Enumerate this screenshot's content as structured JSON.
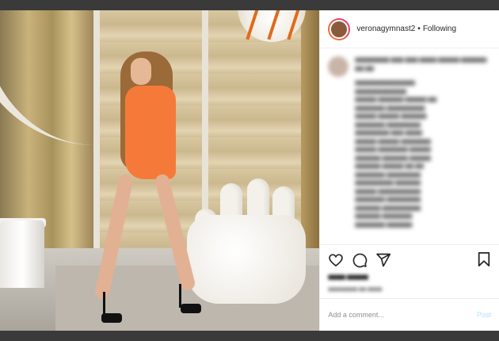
{
  "post": {
    "username": "veronagymnast2",
    "separator": "•",
    "follow_status": "Following",
    "caption_blurred": true
  },
  "actions": {
    "like_icon": "heart-icon",
    "comment_icon": "comment-icon",
    "share_icon": "share-icon",
    "save_icon": "bookmark-icon"
  },
  "comment_box": {
    "placeholder": "Add a comment...",
    "post_label": "Post"
  },
  "colors": {
    "accent_link": "#0095f6",
    "post_disabled": "#b2dffc"
  }
}
